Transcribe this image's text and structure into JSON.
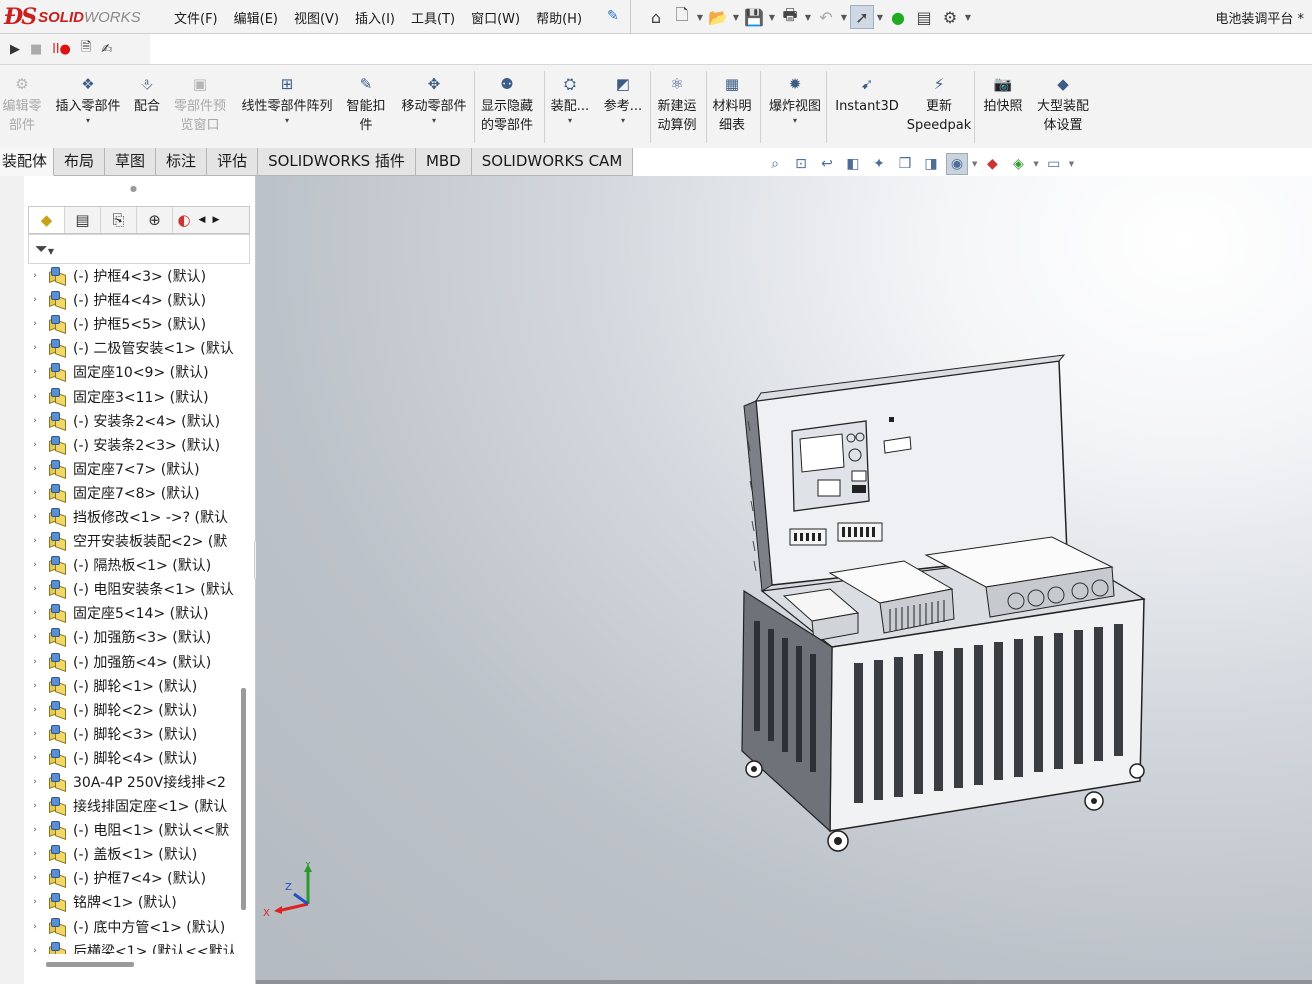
{
  "app": {
    "logo_text": "SOLIDWORKS",
    "document_title": "电池装调平台 *"
  },
  "menu": {
    "items": [
      "文件(F)",
      "编辑(E)",
      "视图(V)",
      "插入(I)",
      "工具(T)",
      "窗口(W)",
      "帮助(H)"
    ],
    "pin_icon": "pin-icon"
  },
  "quick_access": [
    "home-icon",
    "new-document-icon",
    "open-icon",
    "save-icon",
    "print-icon",
    "undo-icon",
    "select-arrow-icon",
    "traffic-light-icon",
    "file-properties-icon",
    "options-gear-icon"
  ],
  "command_manager": {
    "items": [
      {
        "label": "编辑零\n部件",
        "icon": "edit-component-icon",
        "enabled": false,
        "dropdown": false
      },
      {
        "label": "插入零部件",
        "icon": "insert-component-icon",
        "enabled": true,
        "dropdown": true
      },
      {
        "label": "配合",
        "icon": "mate-paperclip-icon",
        "enabled": true,
        "dropdown": false
      },
      {
        "label": "零部件预\n览窗口",
        "icon": "component-preview-icon",
        "enabled": false,
        "dropdown": false
      },
      {
        "label": "线性零部件阵列",
        "icon": "linear-pattern-icon",
        "enabled": true,
        "dropdown": true
      },
      {
        "label": "智能扣\n件",
        "icon": "smart-fasteners-icon",
        "enabled": true,
        "dropdown": false
      },
      {
        "label": "移动零部件",
        "icon": "move-component-icon",
        "enabled": true,
        "dropdown": true
      },
      {
        "label": "显示隐藏\n的零部件",
        "icon": "show-hidden-components-icon",
        "enabled": true,
        "dropdown": false
      },
      {
        "label": "装配...",
        "icon": "assembly-features-icon",
        "enabled": true,
        "dropdown": true
      },
      {
        "label": "参考...",
        "icon": "reference-geometry-icon",
        "enabled": true,
        "dropdown": true
      },
      {
        "label": "新建运\n动算例",
        "icon": "new-motion-study-icon",
        "enabled": true,
        "dropdown": false
      },
      {
        "label": "材料明\n细表",
        "icon": "bill-of-materials-icon",
        "enabled": true,
        "dropdown": false
      },
      {
        "label": "爆炸视图",
        "icon": "exploded-view-icon",
        "enabled": true,
        "dropdown": true
      },
      {
        "label": "Instant3D",
        "icon": "instant3d-icon",
        "enabled": true,
        "dropdown": false
      },
      {
        "label": "更新\nSpeedpak",
        "icon": "update-speedpak-icon",
        "enabled": true,
        "dropdown": false
      },
      {
        "label": "拍快照",
        "icon": "snapshot-camera-icon",
        "enabled": true,
        "dropdown": false
      },
      {
        "label": "大型装配\n体设置",
        "icon": "large-assembly-settings-icon",
        "enabled": true,
        "dropdown": false
      }
    ]
  },
  "tabs": [
    {
      "label": "装配体",
      "active": true
    },
    {
      "label": "布局",
      "active": false
    },
    {
      "label": "草图",
      "active": false
    },
    {
      "label": "标注",
      "active": false
    },
    {
      "label": "评估",
      "active": false
    },
    {
      "label": "SOLIDWORKS 插件",
      "active": false
    },
    {
      "label": "MBD",
      "active": false
    },
    {
      "label": "SOLIDWORKS CAM",
      "active": false
    }
  ],
  "heads_up_toolbar": [
    "zoom-to-fit-icon",
    "zoom-to-area-icon",
    "previous-view-icon",
    "section-view-icon",
    "dynamic-annotation-icon",
    "view-orientation-icon",
    "display-style-icon",
    "hide-show-items-icon",
    "edit-appearance-icon",
    "apply-scene-icon",
    "view-settings-icon"
  ],
  "feature_manager": {
    "tabs": [
      "featuremanager-tree-icon",
      "propertymanager-icon",
      "configurationmanager-icon",
      "dimxpert-icon",
      "display-manager-icon"
    ],
    "filter_icon": "filter-icon",
    "tree_items": [
      "(-) 护框4<3> (默认)",
      "(-) 护框4<4> (默认)",
      "(-) 护框5<5> (默认)",
      "(-) 二极管安装<1> (默认",
      "固定座10<9> (默认)",
      "固定座3<11> (默认)",
      "(-) 安装条2<4> (默认)",
      "(-) 安装条2<3> (默认)",
      "固定座7<7> (默认)",
      "固定座7<8> (默认)",
      "挡板修改<1> ->? (默认",
      "空开安装板装配<2> (默",
      "(-) 隔热板<1> (默认)",
      "(-) 电阻安装条<1> (默认",
      "固定座5<14> (默认)",
      "(-) 加强筋<3> (默认)",
      "(-) 加强筋<4> (默认)",
      "(-) 脚轮<1> (默认)",
      "(-) 脚轮<2> (默认)",
      "(-) 脚轮<3> (默认)",
      "(-) 脚轮<4> (默认)",
      "30A-4P 250V接线排<2",
      "接线排固定座<1> (默认",
      "(-) 电阻<1> (默认<<默",
      "(-) 盖板<1> (默认)",
      "(-) 护框7<4> (默认)",
      "铭牌<1> (默认)",
      "(-) 底中方管<1> (默认)",
      "后横梁<1> (默认<<默认"
    ]
  },
  "triad": {
    "x": "X",
    "y": "Y",
    "z": "Z"
  },
  "colors": {
    "brand_red": "#c8201e",
    "tab_active": "#f7f7f7",
    "tab_inactive": "#e4e4e4"
  }
}
